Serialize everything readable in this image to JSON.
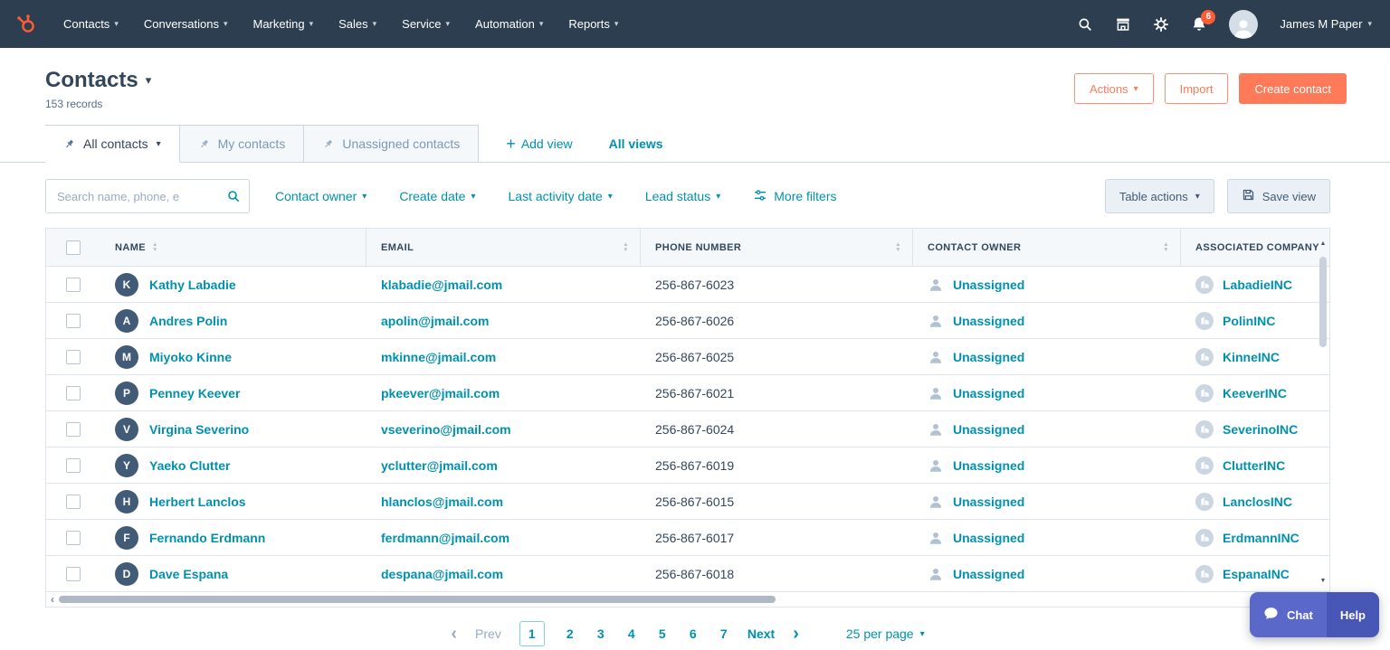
{
  "nav": {
    "items": [
      "Contacts",
      "Conversations",
      "Marketing",
      "Sales",
      "Service",
      "Automation",
      "Reports"
    ],
    "notification_count": "6",
    "user_name": "James M Paper"
  },
  "header": {
    "title": "Contacts",
    "record_count": "153 records",
    "actions_button": "Actions",
    "import_button": "Import",
    "create_button": "Create contact"
  },
  "views": {
    "tabs": [
      {
        "label": "All contacts",
        "active": true,
        "caret": true
      },
      {
        "label": "My contacts"
      },
      {
        "label": "Unassigned contacts"
      }
    ],
    "add_view": "Add view",
    "all_views": "All views"
  },
  "filters": {
    "search_placeholder": "Search name, phone, e",
    "dropdowns": [
      "Contact owner",
      "Create date",
      "Last activity date",
      "Lead status"
    ],
    "more_filters": "More filters",
    "table_actions": "Table actions",
    "save_view": "Save view"
  },
  "table": {
    "columns": [
      "NAME",
      "EMAIL",
      "PHONE NUMBER",
      "CONTACT OWNER",
      "ASSOCIATED COMPANY"
    ],
    "rows": [
      {
        "initial": "K",
        "name": "Kathy Labadie",
        "email": "klabadie@jmail.com",
        "phone": "256-867-6023",
        "owner": "Unassigned",
        "company": "LabadieINC"
      },
      {
        "initial": "A",
        "name": "Andres Polin",
        "email": "apolin@jmail.com",
        "phone": "256-867-6026",
        "owner": "Unassigned",
        "company": "PolinINC"
      },
      {
        "initial": "M",
        "name": "Miyoko Kinne",
        "email": "mkinne@jmail.com",
        "phone": "256-867-6025",
        "owner": "Unassigned",
        "company": "KinneINC"
      },
      {
        "initial": "P",
        "name": "Penney Keever",
        "email": "pkeever@jmail.com",
        "phone": "256-867-6021",
        "owner": "Unassigned",
        "company": "KeeverINC"
      },
      {
        "initial": "V",
        "name": "Virgina Severino",
        "email": "vseverino@jmail.com",
        "phone": "256-867-6024",
        "owner": "Unassigned",
        "company": "SeverinoINC"
      },
      {
        "initial": "Y",
        "name": "Yaeko Clutter",
        "email": "yclutter@jmail.com",
        "phone": "256-867-6019",
        "owner": "Unassigned",
        "company": "ClutterINC"
      },
      {
        "initial": "H",
        "name": "Herbert Lanclos",
        "email": "hlanclos@jmail.com",
        "phone": "256-867-6015",
        "owner": "Unassigned",
        "company": "LanclosINC"
      },
      {
        "initial": "F",
        "name": "Fernando Erdmann",
        "email": "ferdmann@jmail.com",
        "phone": "256-867-6017",
        "owner": "Unassigned",
        "company": "ErdmannINC"
      },
      {
        "initial": "D",
        "name": "Dave Espana",
        "email": "despana@jmail.com",
        "phone": "256-867-6018",
        "owner": "Unassigned",
        "company": "EspanaINC"
      }
    ]
  },
  "pagination": {
    "prev": "Prev",
    "pages": [
      {
        "label": "1",
        "active": true
      },
      {
        "label": "2"
      },
      {
        "label": "3"
      },
      {
        "label": "4"
      },
      {
        "label": "5"
      },
      {
        "label": "6"
      },
      {
        "label": "7"
      }
    ],
    "next": "Next",
    "per_page": "25 per page"
  },
  "beacon": {
    "chat": "Chat",
    "help": "Help"
  },
  "icons": {
    "nav_right": [
      "search-icon",
      "marketplace-icon",
      "settings-icon",
      "notifications-icon"
    ],
    "tab_pin": "pushpin-icon",
    "more_filters": "sliders-icon",
    "save_view": "save-icon",
    "chat": "chat-bubble-icon"
  },
  "colors": {
    "brand_orange": "#ff7a59",
    "nav_bg": "#2d3e50",
    "link_teal": "#0091ae",
    "beacon_blue": "#5a69c9"
  }
}
